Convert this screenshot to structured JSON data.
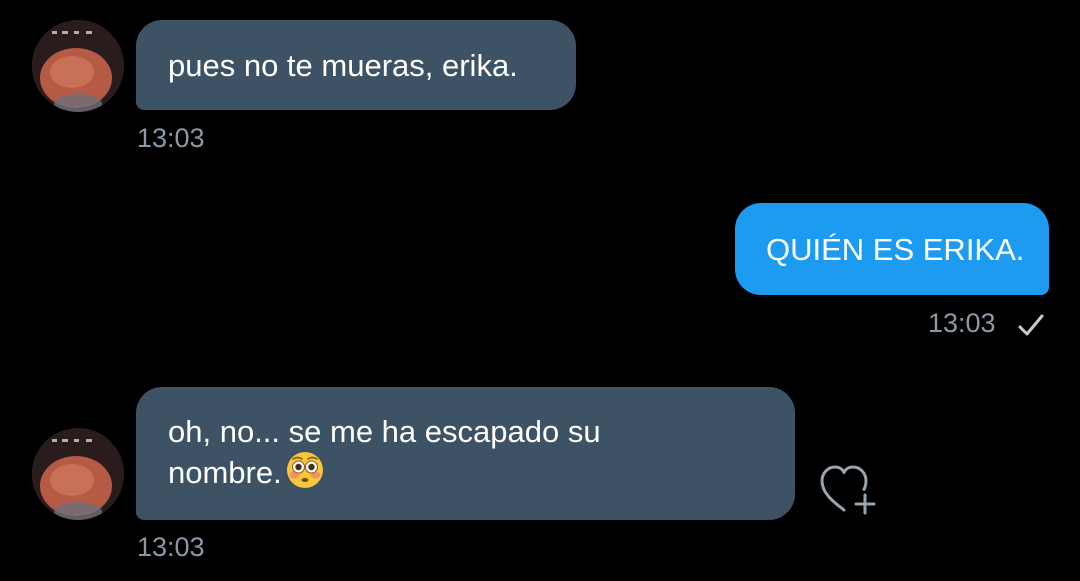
{
  "messages": [
    {
      "direction": "incoming",
      "text": "pues no te mueras, erika.",
      "time": "13:03",
      "avatar": "contact-avatar"
    },
    {
      "direction": "outgoing",
      "text": "QUIÉN ES ERIKA.",
      "time": "13:03",
      "status_icon": "check-icon"
    },
    {
      "direction": "incoming",
      "text_line1": "oh, no... se me ha escapado su",
      "text_line2": "nombre.",
      "emoji": "flushed-face-emoji",
      "time": "13:03",
      "avatar": "contact-avatar",
      "action_icon": "heart-plus-icon"
    }
  ],
  "colors": {
    "background": "#000000",
    "incoming_bubble": "#3d5264",
    "outgoing_bubble": "#1d9bf0",
    "timestamp": "#8b98a5"
  }
}
